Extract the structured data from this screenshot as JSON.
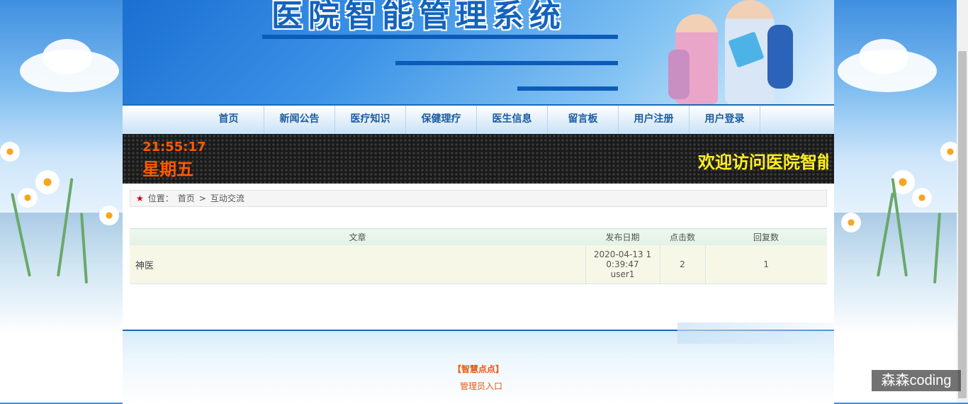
{
  "banner": {
    "title": "医院智能管理系统"
  },
  "nav": {
    "items": [
      {
        "label": "首页"
      },
      {
        "label": "新闻公告"
      },
      {
        "label": "医疗知识"
      },
      {
        "label": "保健理疗"
      },
      {
        "label": "医生信息"
      },
      {
        "label": "留言板"
      },
      {
        "label": "用户注册"
      },
      {
        "label": "用户登录"
      }
    ]
  },
  "ticker": {
    "time": "21:55:17",
    "day": "星期五",
    "marquee": "欢迎访问医院智能管理系统"
  },
  "breadcrumb": {
    "prefix": "位置：",
    "home": "首页",
    "sep": ">",
    "current": "互动交流"
  },
  "table": {
    "headers": [
      "文章",
      "发布日期",
      "点击数",
      "回复数"
    ],
    "rows": [
      {
        "title": "神医",
        "date": "2020-04-13 10:39:47",
        "author": "user1",
        "clicks": "2",
        "replies": "1"
      }
    ]
  },
  "footer": {
    "brand": "【智慧点点】",
    "admin_link": "管理员入口"
  },
  "watermark": "森森coding",
  "colors": {
    "primary": "#1b6ab8",
    "accent": "#e8590c",
    "clock": "#ff5a00",
    "marquee": "#ffee22"
  }
}
